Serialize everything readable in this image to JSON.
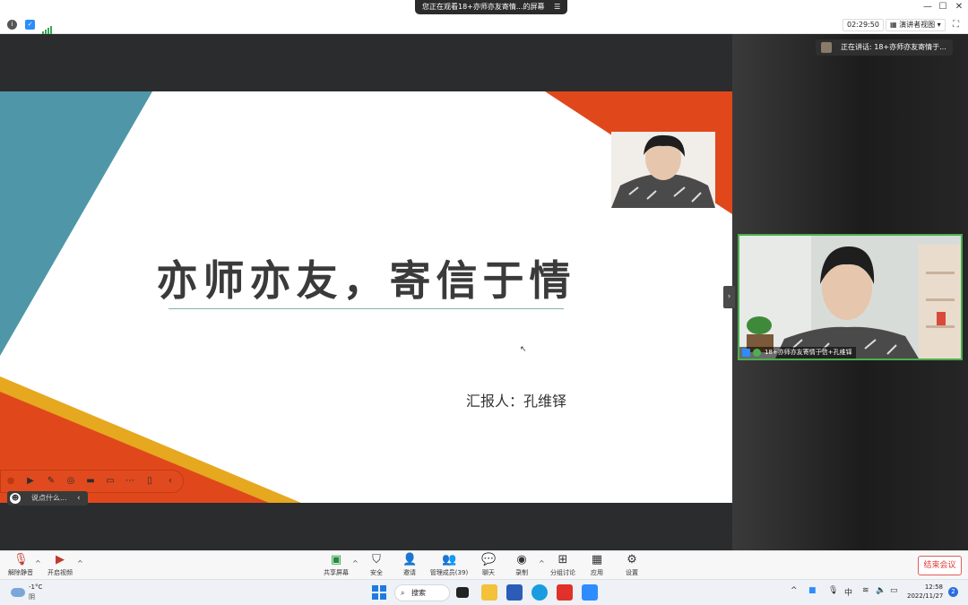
{
  "title_bar": {
    "share_banner": "您正在观看18+亦师亦友寄情...的屏幕",
    "menu_glyph": "☰",
    "minimize": "—",
    "maximize": "☐",
    "close": "✕"
  },
  "info_bar": {
    "timer": "02:29:50",
    "view_button": "演讲者视图"
  },
  "slide": {
    "title": "亦师亦友，寄信于情",
    "reporter": "汇报人：孔维铎",
    "colors": {
      "teal": "#4f97a8",
      "orange": "#e0481c",
      "yellow": "#e5a81f"
    }
  },
  "chat_mini": {
    "placeholder": "说点什么..."
  },
  "right_panel": {
    "speaking": "正在讲话: 18+亦师亦友寄情于...",
    "tile_name": "18+亦师亦友寄情于信+孔维铎"
  },
  "controls": {
    "unmute": "解除静音",
    "start_video": "开启视频",
    "share_screen": "共享屏幕",
    "security": "安全",
    "invite": "邀请",
    "manage_members": "管理成员(39)",
    "chat": "聊天",
    "record": "录制",
    "breakout": "分组讨论",
    "apps": "应用",
    "settings": "设置",
    "end_meeting": "结束会议"
  },
  "taskbar": {
    "temperature": "-1°C",
    "condition": "阴",
    "search": "搜索",
    "ime": "中",
    "time": "12:58",
    "date": "2022/11/27",
    "notifications": "2"
  }
}
